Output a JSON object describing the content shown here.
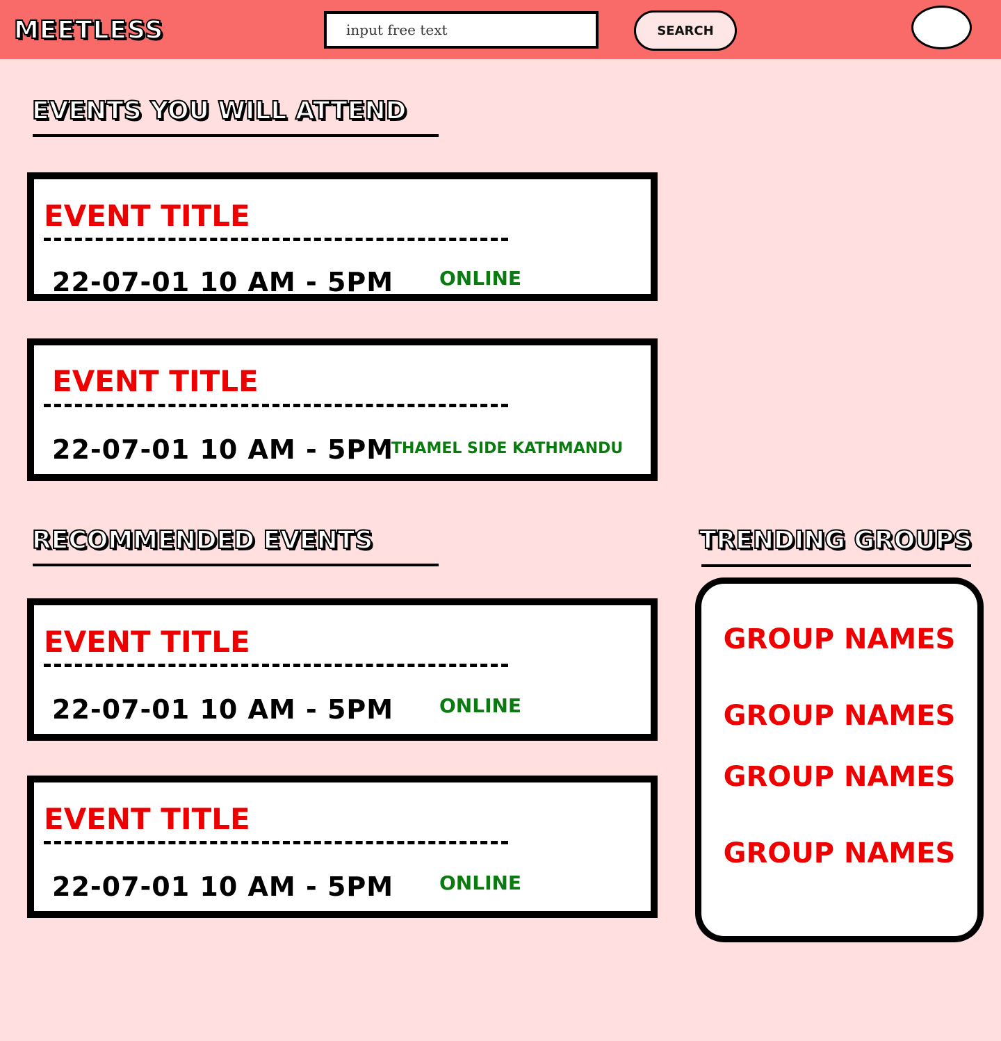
{
  "header": {
    "logo": "MEETLESS",
    "search_placeholder": "input free text",
    "search_button": "SEARCH"
  },
  "attending": {
    "heading": "EVENTS YOU WILL ATTEND",
    "events": [
      {
        "title": "EVENT TITLE",
        "datetime": "22-07-01  10 AM - 5PM",
        "location": "ONLINE"
      },
      {
        "title": "EVENT TITLE",
        "datetime": "22-07-01  10 AM - 5PM",
        "location": "THAMEL SIDE KATHMANDU"
      }
    ]
  },
  "recommended": {
    "heading": "RECOMMENDED EVENTS",
    "events": [
      {
        "title": "EVENT TITLE",
        "datetime": "22-07-01  10 AM - 5PM",
        "location": "ONLINE"
      },
      {
        "title": "EVENT TITLE",
        "datetime": "22-07-01  10 AM - 5PM",
        "location": "ONLINE"
      }
    ]
  },
  "trending": {
    "heading": "TRENDING GROUPS",
    "groups": [
      "GROUP NAMES",
      "GROUP NAMES",
      "GROUP NAMES",
      "GROUP NAMES"
    ]
  },
  "colors": {
    "header_bg": "#f96b68",
    "page_bg": "#ffdfe0",
    "title_red": "#ee0000",
    "location_green": "#0b7a10"
  }
}
